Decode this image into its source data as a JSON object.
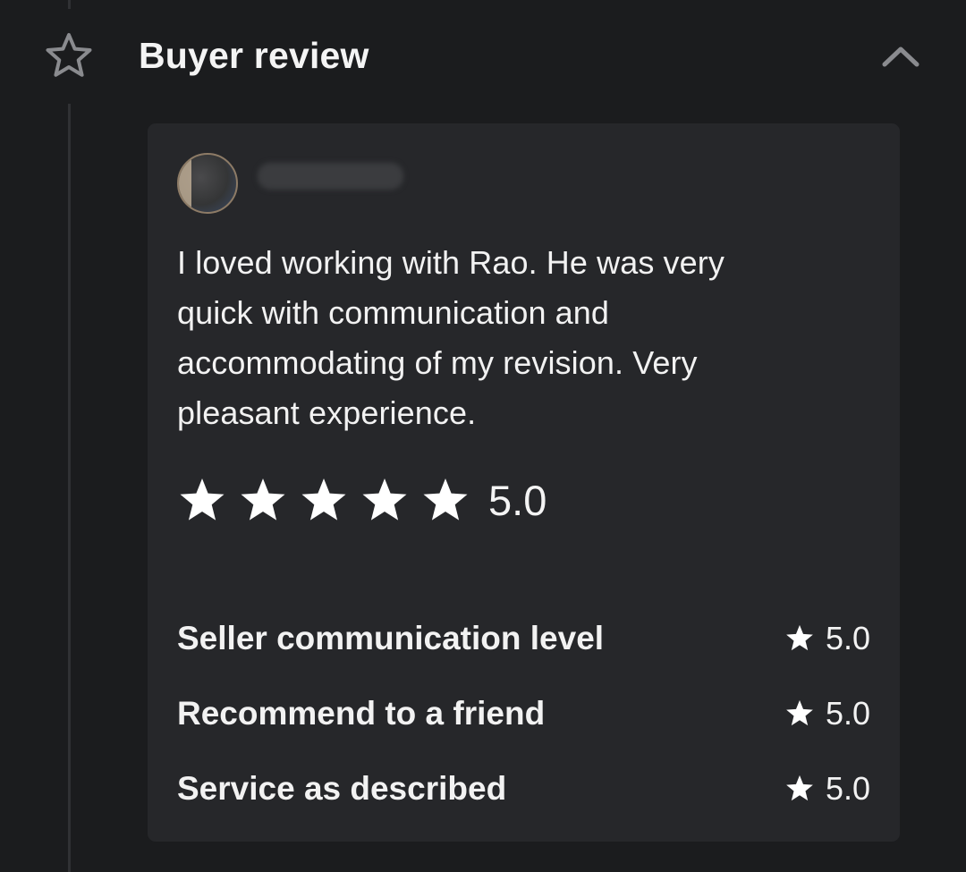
{
  "header": {
    "title": "Buyer review",
    "icon": "star-outline-icon",
    "toggle_icon": "chevron-up-icon"
  },
  "review": {
    "reviewer_avatar": "avatar",
    "text": "I loved working with Rao. He was very quick with communication and accommodating of my revision. Very pleasant experience.",
    "rating": 5,
    "overall_score": "5.0",
    "breakdown": [
      {
        "label": "Seller communication level",
        "score": "5.0"
      },
      {
        "label": "Recommend to a friend",
        "score": "5.0"
      },
      {
        "label": "Service as described",
        "score": "5.0"
      }
    ]
  },
  "colors": {
    "background": "#1b1c1e",
    "card": "#26272a",
    "text": "#f2f2f2",
    "icon_muted": "#8a8b8f"
  }
}
